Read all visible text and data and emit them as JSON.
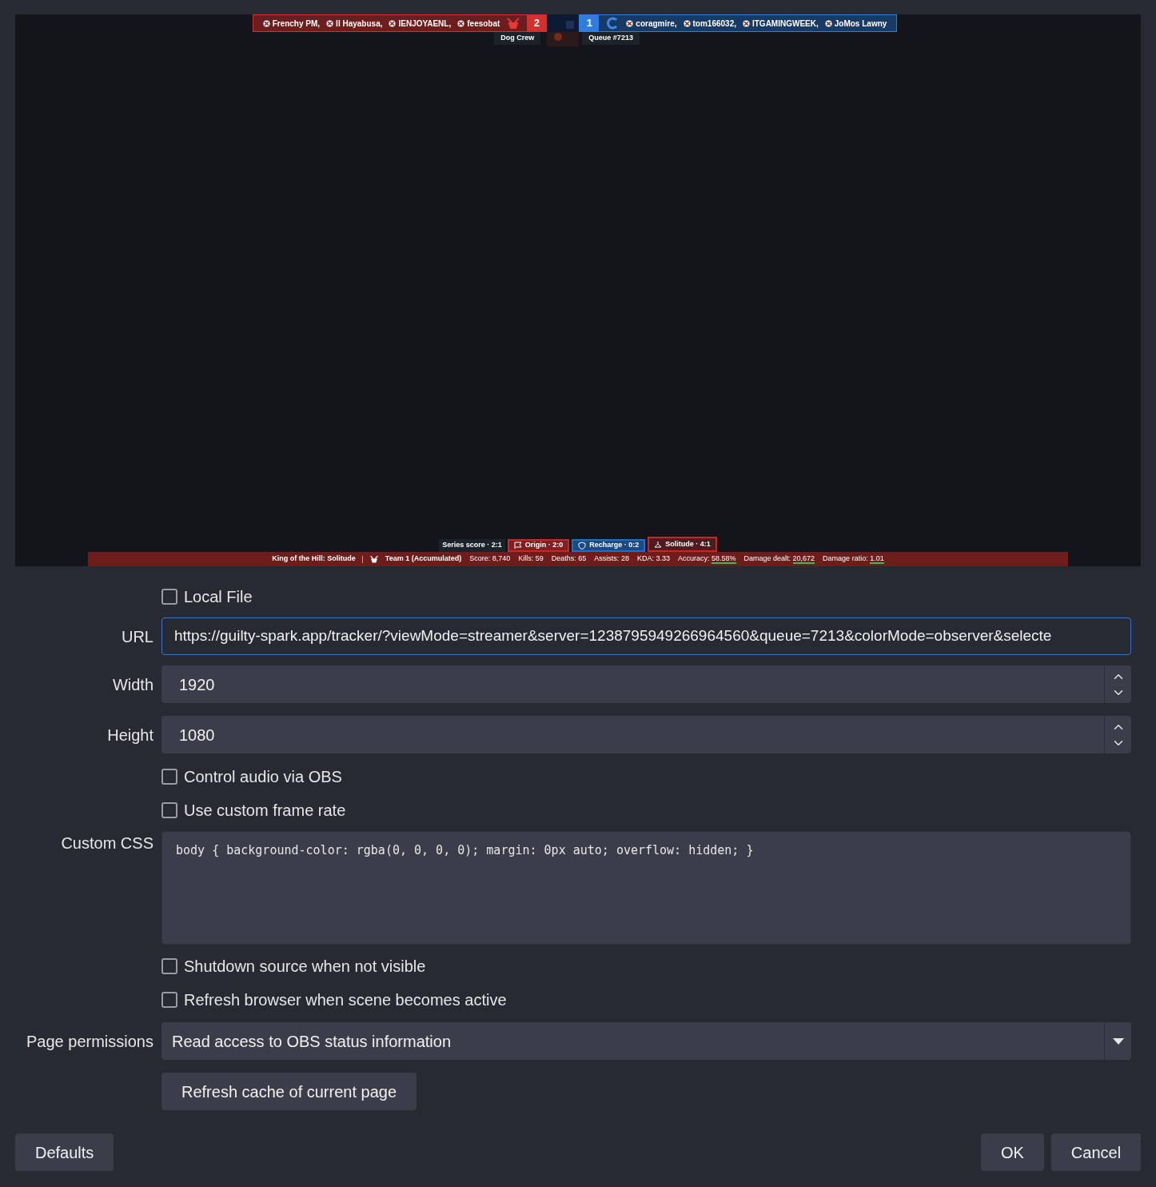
{
  "preview": {
    "team_left": {
      "players": [
        "Frenchy PM,",
        "II Hayabusa,",
        "IENJOYAENL,",
        "feesobat"
      ],
      "score": "2",
      "name": "Dog Crew"
    },
    "team_right": {
      "score": "1",
      "players": [
        "coragmire,",
        "tom166032,",
        "ITGAMINGWEEK,",
        "JoMos Lawny"
      ],
      "queue": "Queue #7213"
    },
    "series_score": "Series score · 2:1",
    "maps": [
      {
        "name": "Origin · 2:0",
        "kind": "flag",
        "color": "#c62828",
        "selected": false
      },
      {
        "name": "Recharge · 0:2",
        "kind": "shield",
        "color": "#1e6fc8",
        "selected": false
      },
      {
        "name": "Solitude · 4:1",
        "kind": "hill",
        "color": "#c62828",
        "selected": true
      }
    ],
    "mode": "King of the Hill: Solitude",
    "team": "Team 1 (Accumulated)",
    "stats": [
      {
        "label": "Score:",
        "value": "8,740",
        "highlighted": false
      },
      {
        "label": "Kills:",
        "value": "59",
        "highlighted": false
      },
      {
        "label": "Deaths:",
        "value": "65",
        "highlighted": false
      },
      {
        "label": "Assists:",
        "value": "28",
        "highlighted": false
      },
      {
        "label": "KDA:",
        "value": "3.33",
        "highlighted": false
      },
      {
        "label": "Accuracy:",
        "value": "58.58%",
        "highlighted": true
      },
      {
        "label": "Damage dealt:",
        "value": "20,672",
        "highlighted": true
      },
      {
        "label": "Damage ratio:",
        "value": "1.01",
        "highlighted": true
      }
    ]
  },
  "form": {
    "local_file": {
      "label": "Local File",
      "checked": false
    },
    "url": {
      "label": "URL",
      "value": "https://guilty-spark.app/tracker/?viewMode=streamer&server=1238795949266964560&queue=7213&colorMode=observer&selecte"
    },
    "width": {
      "label": "Width",
      "value": "1920"
    },
    "height": {
      "label": "Height",
      "value": "1080"
    },
    "options_a": [
      {
        "label": "Control audio via OBS",
        "checked": false
      },
      {
        "label": "Use custom frame rate",
        "checked": false
      }
    ],
    "custom_css": {
      "label": "Custom CSS",
      "value": "body { background-color: rgba(0, 0, 0, 0); margin: 0px auto; overflow: hidden; }"
    },
    "options_b": [
      {
        "label": "Shutdown source when not visible",
        "checked": false
      },
      {
        "label": "Refresh browser when scene becomes active",
        "checked": false
      }
    ],
    "page_permissions": {
      "label": "Page permissions",
      "value": "Read access to OBS status information"
    },
    "refresh_button": "Refresh cache of current page"
  },
  "footer": {
    "defaults": "Defaults",
    "ok": "OK",
    "cancel": "Cancel"
  }
}
